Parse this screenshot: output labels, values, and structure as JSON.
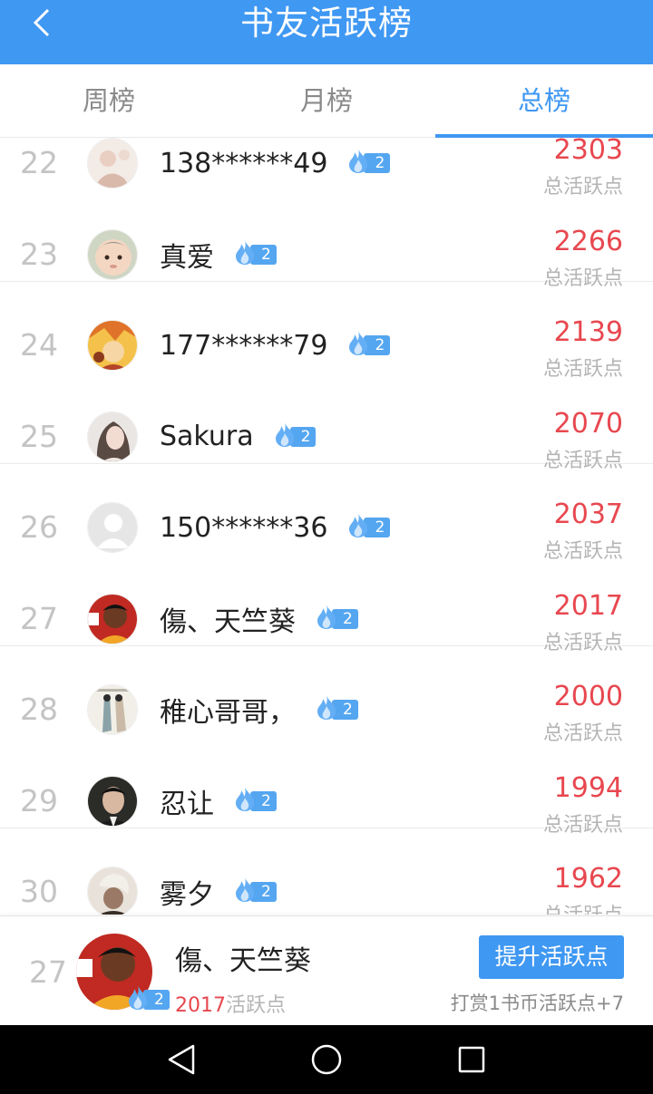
{
  "header": {
    "title": "书友活跃榜"
  },
  "tabs": [
    {
      "label": "周榜"
    },
    {
      "label": "月榜"
    },
    {
      "label": "总榜"
    }
  ],
  "colors": {
    "accent": "#3f98f2",
    "points": "#e8474f",
    "rank": "#c4c4c4"
  },
  "points_label": "总活跃点",
  "rows": [
    {
      "rank": "22",
      "name": "138******49",
      "level": "2",
      "points": "2303"
    },
    {
      "rank": "23",
      "name": "真爱",
      "level": "2",
      "points": "2266"
    },
    {
      "rank": "24",
      "name": "177******79",
      "level": "2",
      "points": "2139"
    },
    {
      "rank": "25",
      "name": "Sakura",
      "level": "2",
      "points": "2070"
    },
    {
      "rank": "26",
      "name": "150******36",
      "level": "2",
      "points": "2037"
    },
    {
      "rank": "27",
      "name": "傷、天竺葵",
      "level": "2",
      "points": "2017"
    },
    {
      "rank": "28",
      "name": "稚心哥哥，",
      "level": "2",
      "points": "2000"
    },
    {
      "rank": "29",
      "name": "忍让",
      "level": "2",
      "points": "1994"
    },
    {
      "rank": "30",
      "name": "雾夕",
      "level": "2",
      "points": "1962"
    }
  ],
  "me": {
    "rank": "27",
    "name": "傷、天竺葵",
    "level": "2",
    "points": "2017",
    "points_suffix": "活跃点",
    "button": "提升活跃点",
    "hint": "打赏1书币活跃点+7"
  }
}
